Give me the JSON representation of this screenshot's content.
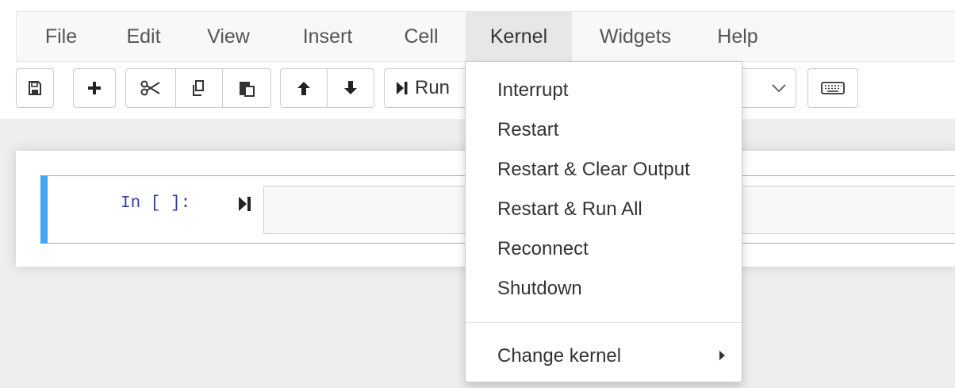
{
  "menubar": {
    "items": [
      {
        "label": "File"
      },
      {
        "label": "Edit"
      },
      {
        "label": "View"
      },
      {
        "label": "Insert"
      },
      {
        "label": "Cell"
      },
      {
        "label": "Kernel",
        "active": true
      },
      {
        "label": "Widgets"
      },
      {
        "label": "Help"
      }
    ]
  },
  "toolbar": {
    "save_icon": "floppy-disk-icon",
    "insert_icon": "plus-icon",
    "cut_icon": "scissors-icon",
    "copy_icon": "copy-icon",
    "paste_icon": "paste-icon",
    "move_up_icon": "arrow-up-icon",
    "move_down_icon": "arrow-down-icon",
    "run_label": "Run",
    "command_palette_icon": "keyboard-icon"
  },
  "cell": {
    "prompt": "In [ ]:",
    "accent_color": "#42a5f5"
  },
  "kernel_menu": {
    "items": [
      {
        "label": "Interrupt"
      },
      {
        "label": "Restart"
      },
      {
        "label": "Restart & Clear Output"
      },
      {
        "label": "Restart & Run All"
      },
      {
        "label": "Reconnect"
      },
      {
        "label": "Shutdown"
      }
    ],
    "submenu_label": "Change kernel"
  }
}
